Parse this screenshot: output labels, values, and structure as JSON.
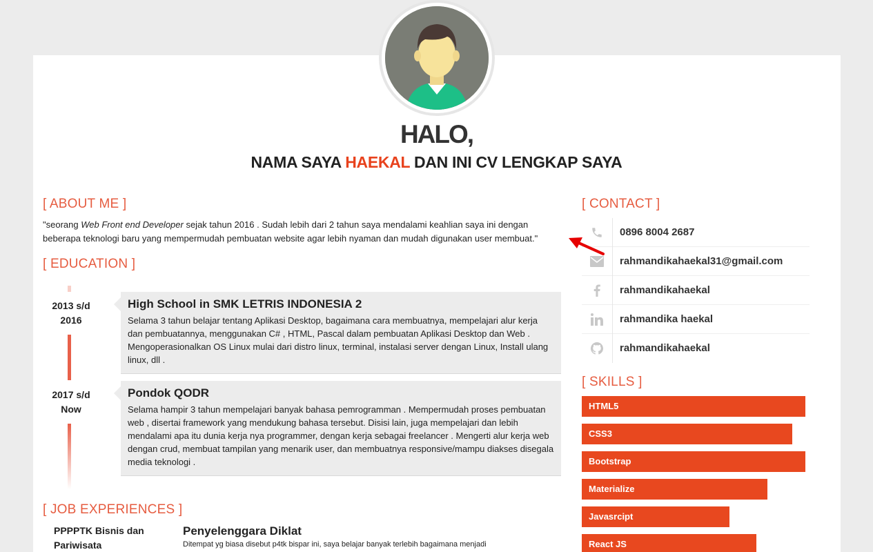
{
  "header": {
    "greeting": "HALO,",
    "subtitle_prefix": "NAMA SAYA ",
    "subtitle_name": "HAEKAL",
    "subtitle_suffix": " DAN INI CV LENGKAP SAYA"
  },
  "about": {
    "title": "[ ABOUT ME ]",
    "text_start": "\"seorang ",
    "text_role": "Web Front end Developer",
    "text_end": " sejak tahun 2016 . Sudah lebih dari 2 tahun saya mendalami keahlian saya ini dengan beberapa teknologi baru yang mempermudah pembuatan website agar lebih nyaman dan mudah digunakan user membuat.\""
  },
  "education": {
    "title": "[ EDUCATION ]",
    "items": [
      {
        "date_line1": "2013 s/d",
        "date_line2": "2016",
        "title": "High School in SMK LETRIS INDONESIA 2",
        "desc": "Selama 3 tahun belajar tentang Aplikasi Desktop, bagaimana cara membuatnya, mempelajari alur kerja dan pembuatannya, menggunakan C# , HTML, Pascal dalam pembuatan Aplikasi Desktop dan Web . Mengoperasionalkan OS Linux mulai dari distro linux, terminal, instalasi server dengan Linux, Install ulang linux, dll ."
      },
      {
        "date_line1": "2017 s/d",
        "date_line2": "Now",
        "title": "Pondok QODR",
        "desc": "Selama hampir 3 tahun mempelajari banyak bahasa pemrogramman . Mempermudah proses pembuatan web , disertai framework yang mendukung bahasa tersebut. Disisi lain, juga mempelajari dan lebih mendalami apa itu dunia kerja nya programmer, dengan kerja sebagai freelancer . Mengerti alur kerja web dengan crud, membuat tampilan yang menarik user, dan membuatnya responsive/mampu diakses disegala media teknologi ."
      }
    ]
  },
  "jobs": {
    "title": "[ JOB EXPERIENCES ]",
    "items": [
      {
        "org": "PPPPTK Bisnis dan Pariwisata",
        "title": "Penyelenggara Diklat",
        "desc": "Ditempat yg biasa disebut p4tk bispar ini, saya belajar banyak terlebih bagaimana menjadi"
      }
    ]
  },
  "contact": {
    "title": "[ CONTACT ]",
    "items": [
      {
        "icon": "phone-icon",
        "text": "0896 8004 2687"
      },
      {
        "icon": "envelope-icon",
        "text": "rahmandikahaekal31@gmail.com"
      },
      {
        "icon": "facebook-icon",
        "text": "rahmandikahaekal"
      },
      {
        "icon": "linkedin-icon",
        "text": "rahmandika haekal"
      },
      {
        "icon": "github-icon",
        "text": "rahmandikahaekal"
      }
    ]
  },
  "skills": {
    "title": "[ SKILLS ]",
    "items": [
      {
        "name": "HTML5",
        "level": 1.0
      },
      {
        "name": "CSS3",
        "level": 0.94
      },
      {
        "name": "Bootstrap",
        "level": 1.0
      },
      {
        "name": "Materialize",
        "level": 0.83
      },
      {
        "name": "Javasrcipt",
        "level": 0.66
      },
      {
        "name": "React JS",
        "level": 0.78
      }
    ]
  },
  "colors": {
    "accent": "#e8421d",
    "section_title": "#e65c40",
    "skill_bar": "#e8481f",
    "page_bg": "#ececec"
  }
}
